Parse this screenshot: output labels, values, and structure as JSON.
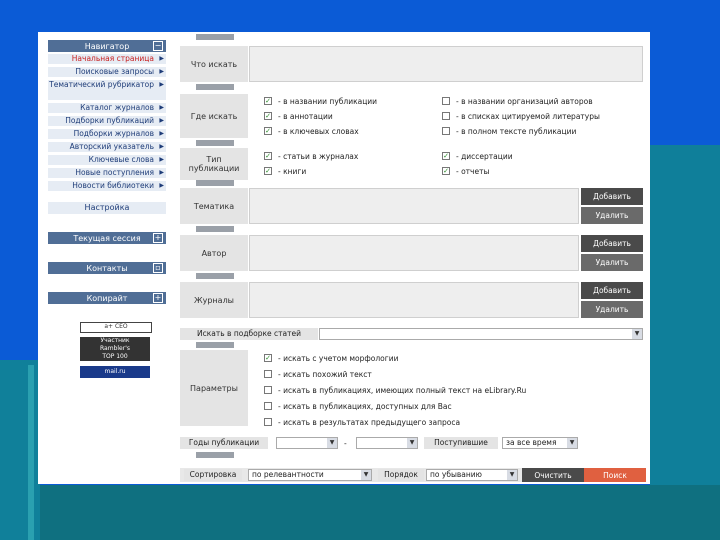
{
  "sidebar": {
    "navigator": {
      "title": "Навигатор",
      "toggle": "−"
    },
    "items": [
      {
        "label": "Начальная страница",
        "active": true
      },
      {
        "label": "Поисковые запросы",
        "active": false
      },
      {
        "label": "Тематический рубрикатор",
        "active": false
      },
      {
        "label": "Каталог журналов",
        "active": false
      },
      {
        "label": "Подборки публикаций",
        "active": false
      },
      {
        "label": "Подборки журналов",
        "active": false
      },
      {
        "label": "Авторский указатель",
        "active": false
      },
      {
        "label": "Ключевые слова",
        "active": false
      },
      {
        "label": "Новые поступления",
        "active": false
      },
      {
        "label": "Новости библиотеки",
        "active": false
      }
    ],
    "settings": "Настройка",
    "current_session": {
      "title": "Текущая сессия",
      "toggle": "+"
    },
    "contacts": {
      "title": "Контакты",
      "toggle": "▫"
    },
    "copyright": {
      "title": "Копирайт",
      "toggle": "+"
    },
    "badges": {
      "search": "а+ СЕО",
      "rambler_1": "Участник",
      "rambler_2": "Rambler's",
      "rambler_3": "TOP 100",
      "mail": "mail.ru"
    }
  },
  "form": {
    "what_label": "Что искать",
    "where_label": "Где искать",
    "where_options": [
      {
        "label": "- в названии публикации",
        "checked": true
      },
      {
        "label": "- в аннотации",
        "checked": true
      },
      {
        "label": "- в ключевых словах",
        "checked": true
      },
      {
        "label": "- в названии организаций авторов",
        "checked": false
      },
      {
        "label": "- в списках цитируемой литературы",
        "checked": false
      },
      {
        "label": "- в полном тексте публикации",
        "checked": false
      }
    ],
    "type_label": "Тип публикации",
    "type_options": [
      {
        "label": "- статьи в журналах",
        "checked": true
      },
      {
        "label": "- книги",
        "checked": true
      },
      {
        "label": "- диссертации",
        "checked": true
      },
      {
        "label": "- отчеты",
        "checked": true
      }
    ],
    "topic_label": "Тематика",
    "author_label": "Автор",
    "journals_label": "Журналы",
    "add_button": "Добавить",
    "remove_button": "Удалить",
    "issue_label": "Искать в подборке статей",
    "params_label": "Параметры",
    "params_options": [
      {
        "label": "- искать с учетом морфологии",
        "checked": true
      },
      {
        "label": "- искать похожий текст",
        "checked": false
      },
      {
        "label": "- искать в публикациях, имеющих полный текст на eLibrary.Ru",
        "checked": false
      },
      {
        "label": "- искать в публикациях, доступных для Вас",
        "checked": false
      },
      {
        "label": "- искать в результатах предыдущего запроса",
        "checked": false
      }
    ],
    "years_label": "Годы публикации",
    "years_dash": "-",
    "received_label": "Поступившие",
    "received_value": "за все время",
    "sort_label": "Сортировка",
    "sort_value": "по релевантности",
    "order_label": "Порядок",
    "order_value": "по убыванию",
    "clear_button": "Очистить",
    "search_button": "Поиск"
  },
  "colors": {
    "background": "#0b5bd6",
    "teal": "#0f7f9a",
    "nav_head": "#506e96",
    "search_button": "#e06040"
  }
}
